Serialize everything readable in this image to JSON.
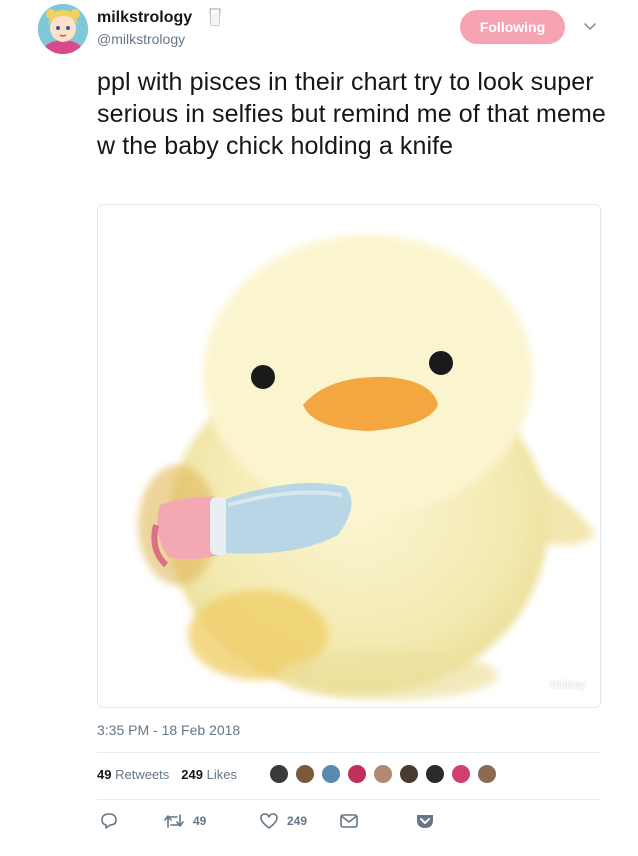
{
  "user": {
    "display_name": "milkstrology",
    "handle": "@milkstrology",
    "avatar_icon": "anime-character-avatar",
    "badge_icon": "milk-glass-icon"
  },
  "follow_button": {
    "label": "Following",
    "color": "#f6a3b3"
  },
  "tweet": {
    "text": "ppl with pisces in their chart try to look super serious in selfies but remind me of that meme w the baby chick holding a knife",
    "media_watermark": "shiitsay",
    "timestamp": "3:35 PM - 18 Feb 2018"
  },
  "stats": {
    "retweets_count": "49",
    "retweets_label": "Retweets",
    "likes_count": "249",
    "likes_label": "Likes"
  },
  "actions": {
    "reply_icon": "reply-icon",
    "retweet_count": "49",
    "like_count": "249",
    "dm_icon": "envelope-icon",
    "bookmark_icon": "pocket-icon"
  },
  "colors": {
    "primary_text": "#14171a",
    "secondary_text": "#657786",
    "divider": "#e6ecf0"
  }
}
